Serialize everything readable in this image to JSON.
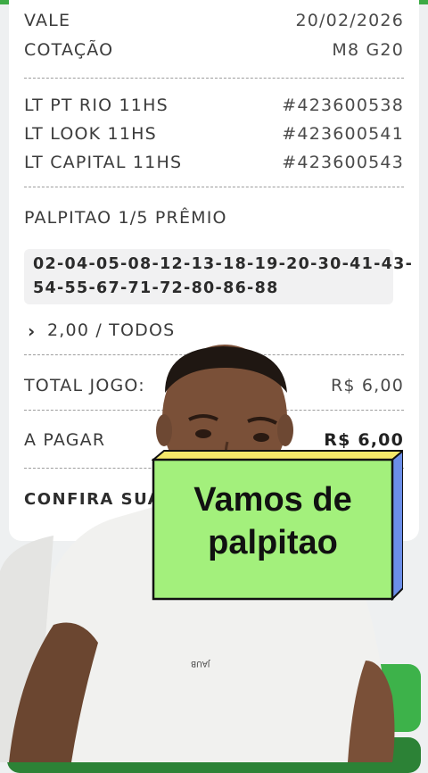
{
  "ticket": {
    "vale": {
      "label": "VALE",
      "value": "20/02/2026"
    },
    "cotacao": {
      "label": "COTAÇÃO",
      "value": "M8 G20"
    },
    "lotteries": [
      {
        "label": "LT PT RIO 11HS",
        "value": "#423600538"
      },
      {
        "label": "LT LOOK 11HS",
        "value": "#423600541"
      },
      {
        "label": "LT CAPITAL 11HS",
        "value": "#423600543"
      }
    ],
    "palpitao_label": "PALPITAO 1/5 PRÊMIO",
    "numbers_line1": "02-04-05-08-12-13-18-19-20-30-41-43-",
    "numbers_line2": "54-55-67-71-72-80-86-88",
    "bet_detail": "2,00 / TODOS",
    "total": {
      "label": "TOTAL JOGO:",
      "value": "R$ 6,00"
    },
    "a_pagar": {
      "label": "A PAGAR",
      "value": "R$ 6,00"
    },
    "confira": "CONFIRA SUA"
  },
  "overlay": {
    "caption_line1": "Vamos de",
    "caption_line2": "palpitao",
    "shirt_text": "JAUB"
  },
  "colors": {
    "accent_green": "#3daa45",
    "sticker_face": "#a3f07c",
    "sticker_top": "#f5e86a",
    "sticker_side": "#6b8ee8"
  }
}
